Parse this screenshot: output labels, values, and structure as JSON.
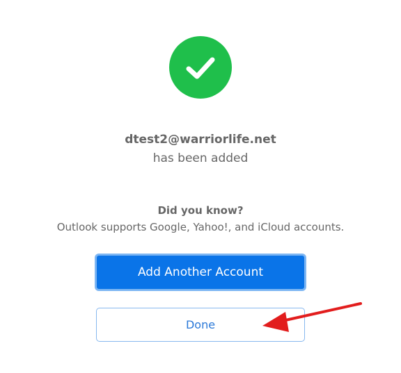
{
  "success": {
    "icon": "check-circle-icon",
    "color": "#1fbf4b"
  },
  "account": {
    "email": "dtest2@warriorlife.net",
    "status": "has been added"
  },
  "info": {
    "heading": "Did you know?",
    "body": "Outlook supports Google, Yahoo!, and iCloud accounts."
  },
  "buttons": {
    "add_another_label": "Add Another Account",
    "done_label": "Done"
  },
  "annotation": {
    "icon": "red-arrow-icon",
    "color": "#e21d1d"
  },
  "colors": {
    "primary_button": "#0a74e8",
    "secondary_text": "#2a78d8",
    "body_text": "#666666"
  }
}
